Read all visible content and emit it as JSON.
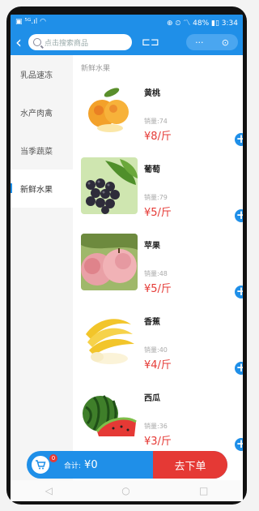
{
  "status": {
    "left": "▣ ⁵ᴳ.ıl ◠",
    "right": "⊕ ⏲ 〽 48% ▮▯ 3:34"
  },
  "header": {
    "back_label": "‹",
    "search_placeholder": "点击搜索商品",
    "scan_label": "⊏⊐",
    "more_label": "···",
    "record_label": "⊙"
  },
  "sidebar": {
    "items": [
      {
        "label": "乳品速冻"
      },
      {
        "label": "水产肉禽"
      },
      {
        "label": "当季蔬菜"
      },
      {
        "label": "新鲜水果"
      }
    ]
  },
  "main": {
    "section_title": "新鲜水果",
    "products": [
      {
        "name": "黄桃",
        "sales": "销量:74",
        "price": "¥8/斤"
      },
      {
        "name": "葡萄",
        "sales": "销量:79",
        "price": "¥5/斤"
      },
      {
        "name": "苹果",
        "sales": "销量:48",
        "price": "¥5/斤"
      },
      {
        "name": "香蕉",
        "sales": "销量:40",
        "price": "¥4/斤"
      },
      {
        "name": "西瓜",
        "sales": "销量:36",
        "price": "¥3/斤"
      }
    ]
  },
  "cart": {
    "badge": "0",
    "total_label": "合计:",
    "total_value": "¥0",
    "order_label": "去下单"
  },
  "navbar": {
    "back": "◁",
    "home": "○",
    "recent": "□"
  },
  "colors": {
    "primary": "#1f8fe8",
    "price_red": "#e53935"
  }
}
